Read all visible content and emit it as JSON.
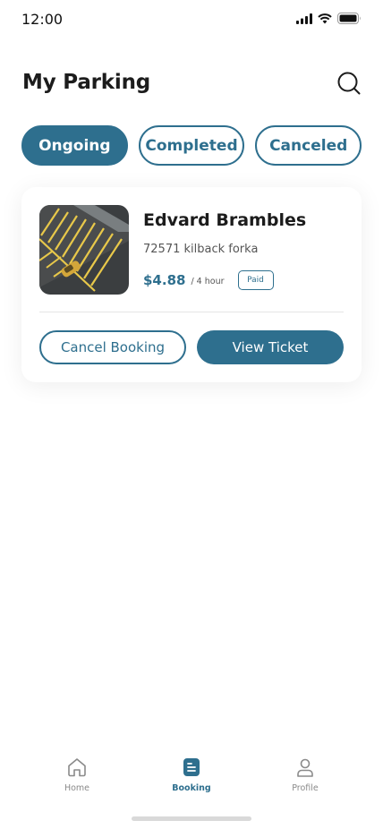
{
  "status_bar": {
    "time": "12:00"
  },
  "header": {
    "title": "My Parking",
    "search_icon": "search-icon"
  },
  "tabs": [
    {
      "label": "Ongoing",
      "active": true
    },
    {
      "label": "Completed",
      "active": false
    },
    {
      "label": "Canceled",
      "active": false
    }
  ],
  "booking": {
    "name": "Edvard Brambles",
    "address": "72571 kilback forka",
    "price": "$4.88",
    "duration": "/ 4 hour",
    "status": "Paid",
    "cancel_label": "Cancel Booking",
    "view_label": "View Ticket"
  },
  "bottom_nav": [
    {
      "label": "Home",
      "icon": "home-icon",
      "active": false
    },
    {
      "label": "Booking",
      "icon": "booking-icon",
      "active": true
    },
    {
      "label": "Profile",
      "icon": "profile-icon",
      "active": false
    }
  ],
  "colors": {
    "accent": "#2e6f8e",
    "text": "#1c1c1c",
    "muted": "#8a8a8a"
  }
}
